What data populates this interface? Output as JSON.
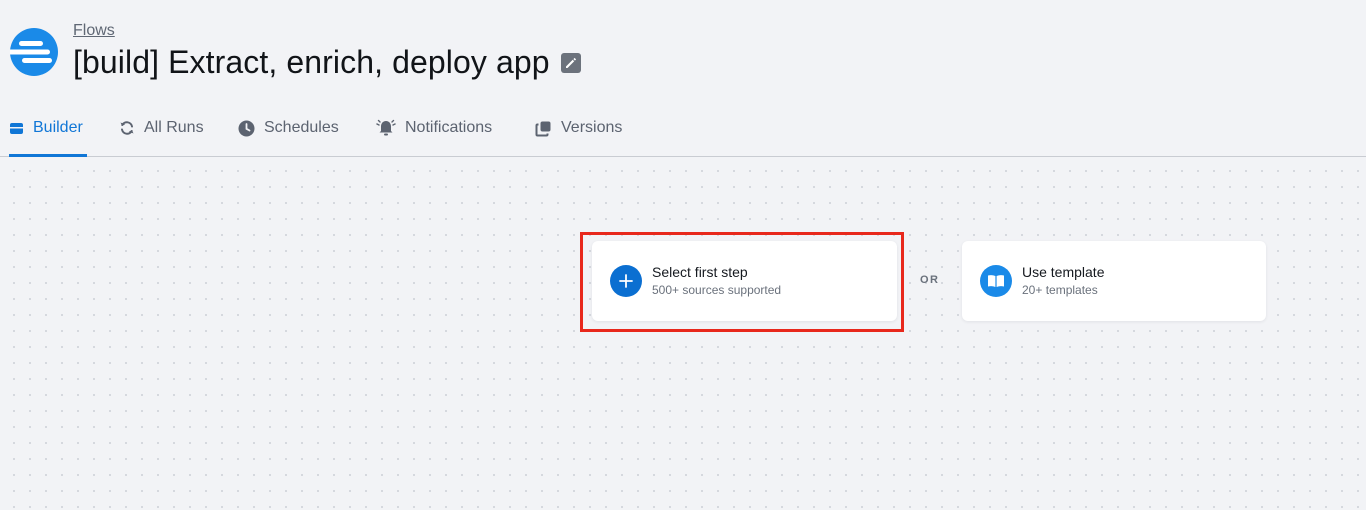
{
  "header": {
    "breadcrumb": "Flows",
    "title": "[build] Extract, enrich, deploy app",
    "logo_icon": "flows-logo-icon",
    "edit_icon": "pencil-icon"
  },
  "tabs": [
    {
      "label": "Builder",
      "icon": "builder-icon",
      "active": true
    },
    {
      "label": "All Runs",
      "icon": "refresh-icon",
      "active": false
    },
    {
      "label": "Schedules",
      "icon": "clock-icon",
      "active": false
    },
    {
      "label": "Notifications",
      "icon": "bell-icon",
      "active": false
    },
    {
      "label": "Versions",
      "icon": "versions-icon",
      "active": false
    }
  ],
  "canvas": {
    "first_step": {
      "title": "Select first step",
      "subtitle": "500+ sources supported",
      "icon": "plus-icon"
    },
    "or_label": "OR",
    "template": {
      "title": "Use template",
      "subtitle": "20+ templates",
      "icon": "book-icon"
    }
  },
  "colors": {
    "accent": "#1076d6",
    "highlight": "#e8281c",
    "background": "#f2f3f6"
  }
}
